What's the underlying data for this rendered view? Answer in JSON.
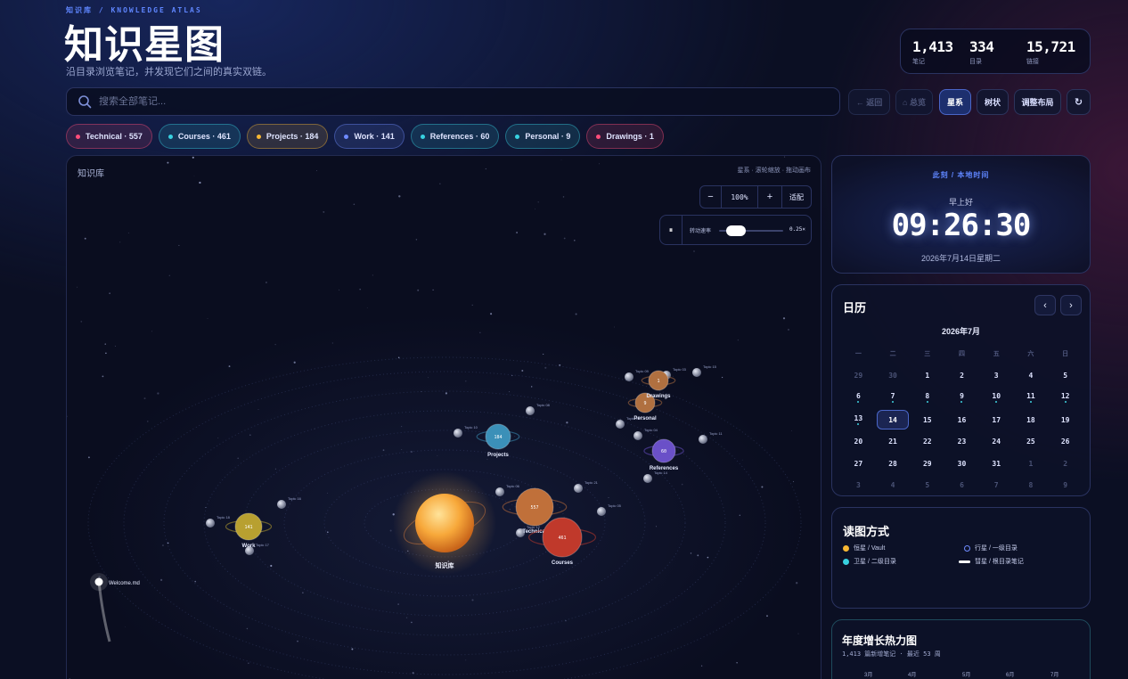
{
  "header": {
    "eyebrow": "知识库 / KNOWLEDGE ATLAS",
    "title": "知识星图",
    "subtitle": "沿目录浏览笔记，并发现它们之间的真实双链。"
  },
  "stats": [
    {
      "value": "1,413",
      "label": "笔记"
    },
    {
      "value": "334",
      "label": "目录"
    },
    {
      "value": "15,721",
      "label": "链接"
    }
  ],
  "search": {
    "placeholder": "搜索全部笔记..."
  },
  "toolbar": {
    "back": "← 返回",
    "overview": "⌂ 总览",
    "galaxy": "星系",
    "tree": "树状",
    "adjust": "调整布局",
    "refresh": "↻"
  },
  "chips": [
    {
      "label": "Technical · 557",
      "color": "#ff4d7a"
    },
    {
      "label": "Courses · 461",
      "color": "#38d1e0"
    },
    {
      "label": "Projects · 184",
      "color": "#f7b733"
    },
    {
      "label": "Work · 141",
      "color": "#6f8bff"
    },
    {
      "label": "References · 60",
      "color": "#38d1e0"
    },
    {
      "label": "Personal · 9",
      "color": "#38d1e0"
    },
    {
      "label": "Drawings · 1",
      "color": "#ff4d7a"
    }
  ],
  "canvas": {
    "title": "知识库",
    "hint": "星系 · 滚轮缩放 · 拖动画布",
    "zoom_minus": "−",
    "zoom_value": "100%",
    "zoom_plus": "+",
    "fit": "适配",
    "pause": "⏸",
    "speed_label": "转动速率",
    "speed_value": "0.25×",
    "speed_level": 0.15,
    "sun_label": "知识库",
    "comet_label": "Welcome.md",
    "planets": [
      {
        "name": "Technical",
        "count": "557",
        "color": "#c0703a"
      },
      {
        "name": "Courses",
        "count": "461",
        "color": "#c0392b"
      },
      {
        "name": "Projects",
        "count": "184",
        "color": "#3b90b8"
      },
      {
        "name": "Work",
        "count": "141",
        "color": "#b8a030"
      },
      {
        "name": "References",
        "count": "60",
        "color": "#6a50c8"
      },
      {
        "name": "Personal",
        "count": "9",
        "color": "#b07040"
      },
      {
        "name": "Drawings",
        "count": "1",
        "color": "#b07040"
      }
    ],
    "moon_labels": [
      "Topic 09",
      "Topic 10",
      "Topic 16",
      "Topic 18",
      "Topic 17",
      "Topic 06",
      "Topic 12",
      "Topic 21",
      "Topic 08",
      "Topic 13",
      "Topic 14",
      "Topic 15",
      "Topic 03",
      "Topic 04",
      "Topic 11",
      "Topic 05"
    ]
  },
  "clock": {
    "header": "此刻 / 本地时间",
    "greeting": "早上好",
    "time": "09:26:30",
    "date": "2026年7月14日星期二"
  },
  "calendar": {
    "title": "日历",
    "prev": "‹",
    "next": "›",
    "month": "2026年7月",
    "weekdays": [
      "一",
      "二",
      "三",
      "四",
      "五",
      "六",
      "日"
    ],
    "days": [
      {
        "d": "29",
        "out": true
      },
      {
        "d": "30",
        "out": true
      },
      {
        "d": "1"
      },
      {
        "d": "2"
      },
      {
        "d": "3"
      },
      {
        "d": "4"
      },
      {
        "d": "5"
      },
      {
        "d": "6",
        "mark": true
      },
      {
        "d": "7",
        "mark": true
      },
      {
        "d": "8",
        "mark": true
      },
      {
        "d": "9",
        "mark": true
      },
      {
        "d": "10",
        "mark": true
      },
      {
        "d": "11",
        "mark": true
      },
      {
        "d": "12",
        "mark": true
      },
      {
        "d": "13",
        "mark": true
      },
      {
        "d": "14",
        "today": true
      },
      {
        "d": "15"
      },
      {
        "d": "16"
      },
      {
        "d": "17"
      },
      {
        "d": "18"
      },
      {
        "d": "19"
      },
      {
        "d": "20"
      },
      {
        "d": "21"
      },
      {
        "d": "22"
      },
      {
        "d": "23"
      },
      {
        "d": "24"
      },
      {
        "d": "25"
      },
      {
        "d": "26"
      },
      {
        "d": "27"
      },
      {
        "d": "28"
      },
      {
        "d": "29"
      },
      {
        "d": "30"
      },
      {
        "d": "31"
      },
      {
        "d": "1",
        "out": true
      },
      {
        "d": "2",
        "out": true
      },
      {
        "d": "3",
        "out": true
      },
      {
        "d": "4",
        "out": true
      },
      {
        "d": "5",
        "out": true
      },
      {
        "d": "6",
        "out": true
      },
      {
        "d": "7",
        "out": true
      },
      {
        "d": "8",
        "out": true
      },
      {
        "d": "9",
        "out": true
      }
    ]
  },
  "legend": {
    "title": "读图方式",
    "items": [
      {
        "label": "恒星 / Vault",
        "color": "#f7b733"
      },
      {
        "label": "行星 / 一级目录",
        "color": "#6f8bff"
      },
      {
        "label": "卫星 / 二级目录",
        "color": "#38d1e0"
      },
      {
        "label": "彗星 / 根目录笔记",
        "color": "#ffffff"
      }
    ]
  },
  "heatmap": {
    "title": "年度增长热力图",
    "subtitle": "1,413 篇新增笔记 · 最近 53 周",
    "months": [
      "3月",
      "4月",
      "5月",
      "6月",
      "7月"
    ]
  }
}
